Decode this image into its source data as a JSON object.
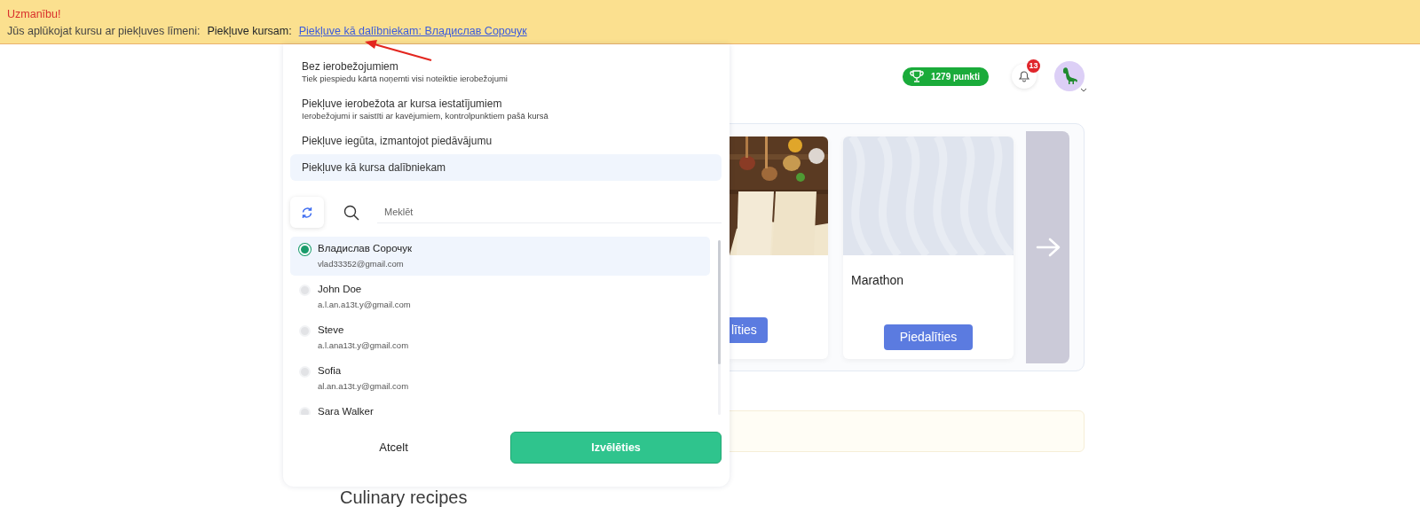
{
  "banner": {
    "title": "Uzmanību!",
    "text": "Jūs aplūkojat kursu ar piekļuves līmeni:",
    "label": "Piekļuve kursam:",
    "link": "Piekļuve kā dalībniekam: Владислав Сорочук"
  },
  "header": {
    "points": "1279 punkti",
    "notifications": "13"
  },
  "courses": [
    {
      "button": "līties"
    },
    {
      "kind": "placeholder",
      "title": "Marathon",
      "button": "Piedalīties"
    }
  ],
  "section_title": "Culinary recipes",
  "access_menu": {
    "options": [
      {
        "title": "Bez ierobežojumiem",
        "subtitle": "Tiek piespiedu kārtā noņemti visi noteiktie ierobežojumi",
        "selected": false
      },
      {
        "title": "Piekļuve ierobežota ar kursa iestatījumiem",
        "subtitle": "Ierobežojumi ir saistīti ar kavējumiem, kontrolpunktiem pašā kursā",
        "selected": false
      },
      {
        "title": "Piekļuve iegūta, izmantojot piedāvājumu",
        "selected": false
      },
      {
        "title": "Piekļuve kā kursa dalībniekam",
        "selected": true
      }
    ],
    "search": {
      "placeholder": "Meklēt"
    },
    "participants": [
      {
        "name": "Владислав Сорочук",
        "email": "vlad33352@gmail.com",
        "selected": true
      },
      {
        "name": "John Doe",
        "email": "a.l.an.a13t.y@gmail.com",
        "selected": false
      },
      {
        "name": "Steve",
        "email": "a.l.ana13t.y@gmail.com",
        "selected": false
      },
      {
        "name": "Sofia",
        "email": "al.an.a13t.y@gmail.com",
        "selected": false
      },
      {
        "name": "Sara Walker",
        "selected": false
      }
    ],
    "cancel": "Atcelt",
    "confirm": "Izvēlēties"
  }
}
